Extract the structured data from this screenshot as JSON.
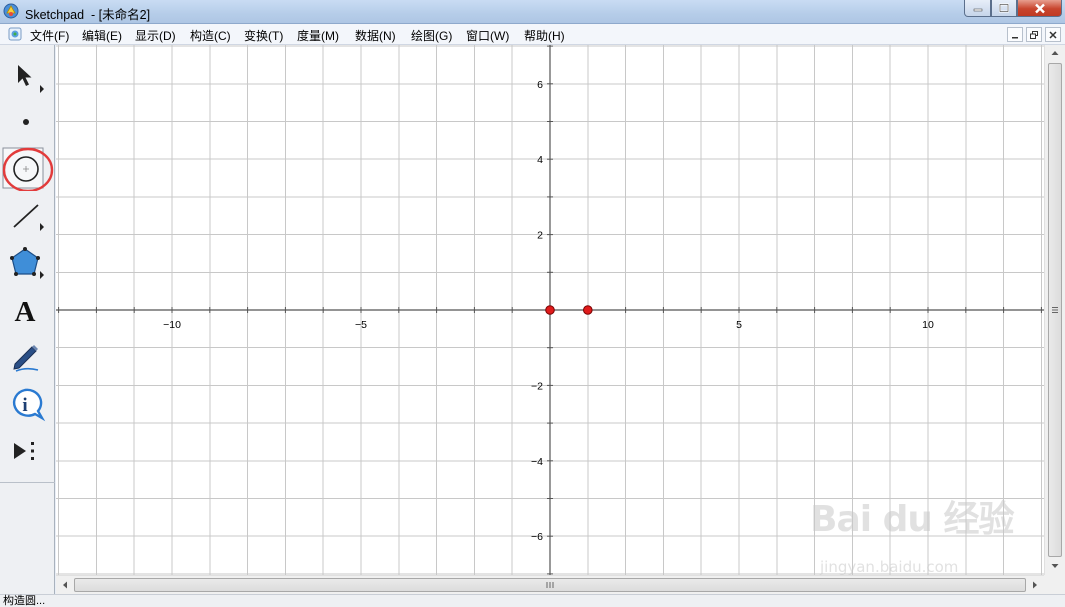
{
  "window": {
    "title": "Sketchpad  - [未命名2]",
    "app_icon": "sketchpad-logo-icon",
    "controls": [
      "minimize-icon",
      "maximize-icon",
      "close-icon"
    ]
  },
  "menubar": {
    "doc_icon": "document-icon",
    "items": [
      {
        "label": "文件(F)"
      },
      {
        "label": "编辑(E)"
      },
      {
        "label": "显示(D)"
      },
      {
        "label": "构造(C)"
      },
      {
        "label": "变换(T)"
      },
      {
        "label": "度量(M)"
      },
      {
        "label": "数据(N)"
      },
      {
        "label": "绘图(G)"
      },
      {
        "label": "窗口(W)"
      },
      {
        "label": "帮助(H)"
      }
    ],
    "mdi_controls": [
      "minimize-icon",
      "restore-icon",
      "close-icon"
    ]
  },
  "toolbox": {
    "tools": [
      {
        "name": "arrow-tool",
        "icon": "arrow-select-icon",
        "has_submenu": true
      },
      {
        "name": "point-tool",
        "icon": "point-icon",
        "has_submenu": false
      },
      {
        "name": "compass-tool",
        "icon": "circle-compass-icon",
        "has_submenu": false,
        "selected": true,
        "highlighted_red": true
      },
      {
        "name": "straightedge-tool",
        "icon": "line-segment-icon",
        "has_submenu": true
      },
      {
        "name": "polygon-tool",
        "icon": "polygon-icon",
        "has_submenu": true
      },
      {
        "name": "text-tool",
        "icon": "text-a-icon",
        "has_submenu": false
      },
      {
        "name": "marker-tool",
        "icon": "marker-pen-icon",
        "has_submenu": false
      },
      {
        "name": "information-tool",
        "icon": "info-icon",
        "has_submenu": false
      },
      {
        "name": "custom-tool",
        "icon": "custom-tools-icon",
        "has_submenu": false
      }
    ],
    "highlight_color": "#e23b3b"
  },
  "coordinate_plane": {
    "x_range": [
      -13,
      13
    ],
    "y_range": [
      -7,
      7
    ],
    "grid_step": 1,
    "x_tick_labels": [
      "−10",
      "−5",
      "5",
      "10"
    ],
    "y_tick_labels": [
      "6",
      "4",
      "2",
      "−2",
      "−4",
      "−6"
    ],
    "axis_color": "#555555",
    "grid_color": "#c8c8c8",
    "points": [
      {
        "label": "origin",
        "x": 0,
        "y": 0
      },
      {
        "label": "unit-point",
        "x": 1,
        "y": 0
      }
    ],
    "point_color": "#e01b1b"
  },
  "statusbar": {
    "text": "构造圆..."
  },
  "watermark": {
    "logo": "Bai du 经验",
    "url": "jingyan.baidu.com"
  }
}
